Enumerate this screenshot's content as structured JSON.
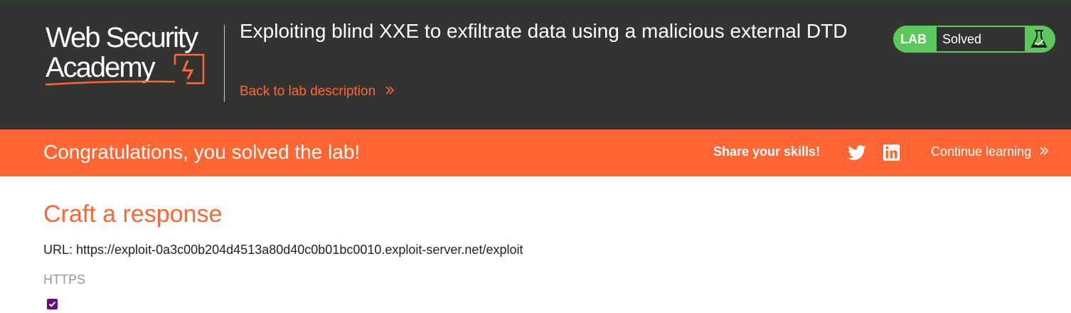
{
  "header": {
    "logo_line1": "Web Security",
    "logo_line2": "Academy",
    "lab_title": "Exploiting blind XXE to exfiltrate data using a malicious external DTD",
    "back_link": "Back to lab description",
    "lab_status_label": "LAB",
    "lab_status_value": "Solved"
  },
  "banner": {
    "message": "Congratulations, you solved the lab!",
    "share_label": "Share your skills!",
    "continue_link": "Continue learning"
  },
  "content": {
    "title": "Craft a response",
    "url_line": "URL: https://exploit-0a3c00b204d4513a80d40c0b01bc0010.exploit-server.net/exploit",
    "https_label": "HTTPS",
    "https_checked": true
  },
  "icons": {
    "back_chevron": "double-chevron-right-icon",
    "continue_chevron": "double-chevron-right-icon",
    "twitter": "twitter-icon",
    "linkedin": "linkedin-icon",
    "flask": "flask-icon",
    "logo_mark": "lightning-bolt-icon"
  },
  "colors": {
    "header_bg": "#333332",
    "accent_orange": "#ff6633",
    "solved_green": "#5bc85b",
    "checkbox_purple": "#660e7a"
  }
}
